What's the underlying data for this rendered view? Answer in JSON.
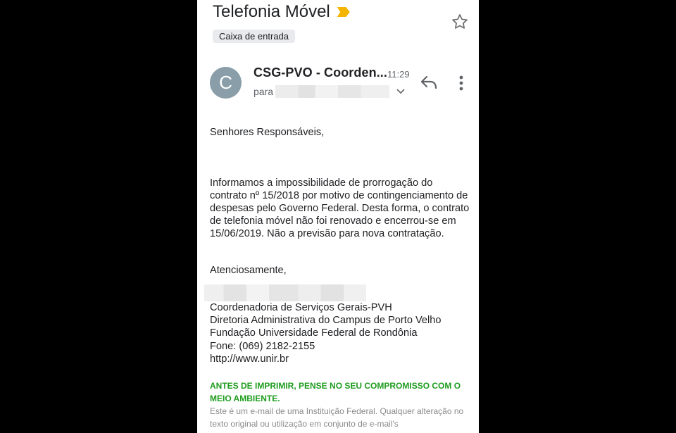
{
  "email": {
    "subject": "Telefonia Móvel",
    "label": "Caixa de entrada",
    "sender_initial": "C",
    "sender_name": "CSG-PVO - Coorden...",
    "time": "11:29",
    "to_label": "para"
  },
  "body": {
    "greeting": "Senhores Responsáveis,",
    "paragraph": "Informamos a impossibilidade de prorrogação do contrato nº 15/2018 por motivo de contingenciamento de despesas pelo Governo Federal. Desta forma, o contrato de telefonia móvel não foi renovado e encerrou-se em 15/06/2019. Não a previsão para nova contratação.",
    "closing": "Atenciosamente,",
    "signature": {
      "line1": "Coordenadoria de Serviços Gerais-PVH",
      "line2": "Diretoria Administrativa do Campus de Porto Velho",
      "line3": "Fundação Universidade Federal de Rondônia",
      "line4": "Fone: (069) 2182-2155",
      "line5": "http://www.unir.br"
    },
    "environment_notice": "ANTES DE IMPRIMIR, PENSE NO SEU COMPROMISSO COM O MEIO AMBIENTE.",
    "disclaimer": "Este é um e-mail de uma Instituição Federal. Qualquer alteração no texto original ou utilização em conjunto de e-mail's"
  },
  "icons": {
    "star": "star-outline-icon",
    "importance": "importance-marker-icon",
    "reply": "reply-icon",
    "more": "more-vertical-icon",
    "expand": "chevron-down-icon"
  },
  "colors": {
    "importance": "#f4b400",
    "avatar": "#8a9ea9",
    "notice_green": "#1e9c1e"
  }
}
